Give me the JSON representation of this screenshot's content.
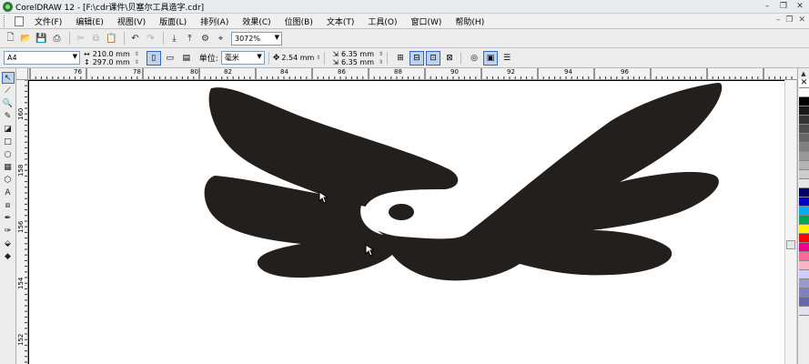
{
  "window": {
    "title": "CorelDRAW 12 - [F:\\cdr课件\\贝塞尔工具造字.cdr]"
  },
  "menu": {
    "items": [
      "文件(F)",
      "编辑(E)",
      "视图(V)",
      "版面(L)",
      "排列(A)",
      "效果(C)",
      "位图(B)",
      "文本(T)",
      "工具(O)",
      "窗口(W)",
      "帮助(H)"
    ]
  },
  "standard_toolbar": {
    "zoom_level": "3072%"
  },
  "property_bar": {
    "paper_size": "A4",
    "width": "210.0 mm",
    "height": "297.0 mm",
    "units_label": "单位:",
    "units_value": "毫米",
    "nudge": "2.54 mm",
    "dup_x": "6.35 mm",
    "dup_y": "6.35 mm"
  },
  "hruler": {
    "labels": [
      "76",
      "78",
      "80",
      "82",
      "84",
      "86",
      "88",
      "90",
      "92",
      "94",
      "96"
    ]
  },
  "vruler": {
    "labels": [
      "160",
      "158",
      "156",
      "154",
      "152"
    ]
  },
  "canvas": {
    "shape_color": "#231f1c"
  },
  "palette": {
    "colors": [
      "#ffffff",
      "#000000",
      "#1a1a1a",
      "#333333",
      "#4d4d4d",
      "#666666",
      "#808080",
      "#999999",
      "#b3b3b3",
      "#cccccc",
      "#e6e6e6",
      "#000066",
      "#0000cc",
      "#00aeef",
      "#00a651",
      "#fff200",
      "#ff0000",
      "#ec008c",
      "#ff6699",
      "#ffb3c6",
      "#ccccff",
      "#9999cc",
      "#8080c0",
      "#6666aa",
      "#e0e0f0"
    ]
  }
}
